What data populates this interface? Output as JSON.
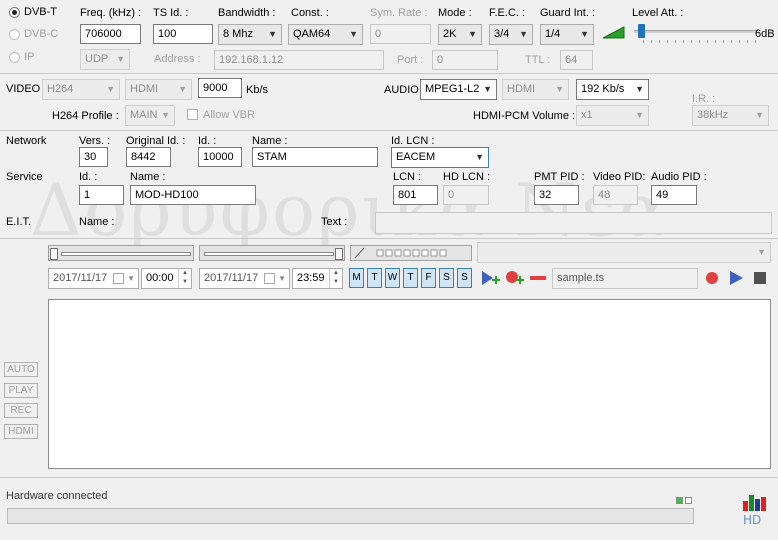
{
  "standards": [
    {
      "label": "DVB-T",
      "selected": true,
      "enabled": true
    },
    {
      "label": "DVB-C",
      "selected": false,
      "enabled": false
    },
    {
      "label": "IP",
      "selected": false,
      "enabled": false
    }
  ],
  "tuning": {
    "freq_label": "Freq. (kHz) :",
    "freq_value": "706000",
    "tsid_label": "TS Id. :",
    "tsid_value": "100",
    "bandwidth_label": "Bandwidth :",
    "bandwidth_value": "8 Mhz",
    "const_label": "Const. :",
    "const_value": "QAM64",
    "symrate_label": "Sym. Rate :",
    "symrate_value": "0",
    "mode_label": "Mode :",
    "mode_value": "2K",
    "fec_label": "F.E.C. :",
    "fec_value": "3/4",
    "guard_label": "Guard Int. :",
    "guard_value": "1/4",
    "level_label": "Level Att. :",
    "level_value": "6dB"
  },
  "ip": {
    "protocol": "UDP",
    "address_label": "Address :",
    "address_value": "192.168.1.12",
    "port_label": "Port :",
    "port_value": "0",
    "ttl_label": "TTL :",
    "ttl_value": "64"
  },
  "video": {
    "label": "VIDEO",
    "codec": "H264",
    "input": "HDMI",
    "bitrate": "9000",
    "bitrate_unit": "Kb/s",
    "profile_label": "H264 Profile :",
    "profile_value": "MAIN",
    "allow_vbr": "Allow VBR"
  },
  "audio": {
    "label": "AUDIO",
    "codec": "MPEG1-L2",
    "input": "HDMI",
    "bitrate": "192 Kb/s",
    "pcm_label": "HDMI-PCM Volume :",
    "pcm_value": "x1",
    "ir_label": "I.R. :",
    "ir_value": "38kHz"
  },
  "network": {
    "label": "Network",
    "vers_label": "Vers. :",
    "vers_value": "30",
    "origid_label": "Original Id. :",
    "origid_value": "8442",
    "id_label": "Id. :",
    "id_value": "10000",
    "name_label": "Name :",
    "name_value": "STAM",
    "lcn_label": "Id. LCN :",
    "lcn_value": "EACEM"
  },
  "service": {
    "label": "Service",
    "id_label": "Id. :",
    "id_value": "1",
    "name_label": "Name :",
    "name_value": "MOD-HD100",
    "lcn_label": "LCN :",
    "lcn_value": "801",
    "hdlcn_label": "HD LCN :",
    "hdlcn_value": "0",
    "pmt_label": "PMT PID :",
    "pmt_value": "32",
    "vpid_label": "Video PID:",
    "vpid_value": "48",
    "apid_label": "Audio PID :",
    "apid_value": "49"
  },
  "eit": {
    "label": "E.I.T.",
    "name_label": "Name :",
    "text_label": "Text :"
  },
  "schedule": {
    "start_date": "2017/11/17",
    "start_time": "00:00",
    "end_date": "2017/11/17",
    "end_time": "23:59",
    "days": [
      "M",
      "T",
      "W",
      "T",
      "F",
      "S",
      "S"
    ],
    "filename": "sample.ts"
  },
  "side_buttons": [
    "AUTO",
    "PLAY",
    "REC",
    "HDMI"
  ],
  "watermark": "Δορυφορικα Νεα",
  "status": {
    "text": "Hardware connected"
  },
  "colors": {
    "accent": "#3c7fb1",
    "record": "#e04040",
    "play": "#4060c0",
    "add": "#2aa02a"
  }
}
